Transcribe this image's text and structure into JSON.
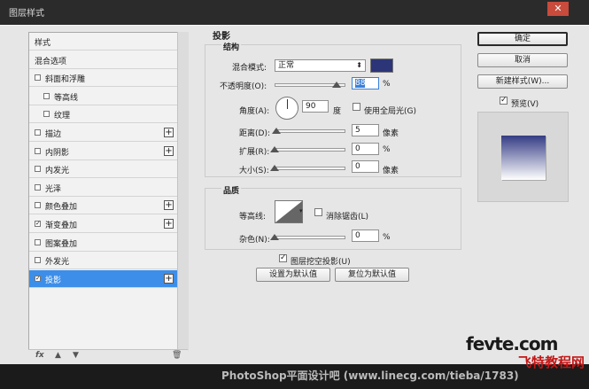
{
  "window": {
    "title": "图层样式",
    "close": "✕"
  },
  "left_panel": {
    "items": [
      {
        "label": "样式",
        "checkbox": false,
        "checked": false,
        "plus": false,
        "indent": 0,
        "selected": false
      },
      {
        "label": "混合选项",
        "checkbox": false,
        "checked": false,
        "plus": false,
        "indent": 0,
        "selected": false
      },
      {
        "label": "斜面和浮雕",
        "checkbox": true,
        "checked": false,
        "plus": false,
        "indent": 0,
        "selected": false
      },
      {
        "label": "等高线",
        "checkbox": true,
        "checked": false,
        "plus": false,
        "indent": 1,
        "selected": false
      },
      {
        "label": "纹理",
        "checkbox": true,
        "checked": false,
        "plus": false,
        "indent": 1,
        "selected": false
      },
      {
        "label": "描边",
        "checkbox": true,
        "checked": false,
        "plus": true,
        "indent": 0,
        "selected": false
      },
      {
        "label": "内阴影",
        "checkbox": true,
        "checked": false,
        "plus": true,
        "indent": 0,
        "selected": false
      },
      {
        "label": "内发光",
        "checkbox": true,
        "checked": false,
        "plus": false,
        "indent": 0,
        "selected": false
      },
      {
        "label": "光泽",
        "checkbox": true,
        "checked": false,
        "plus": false,
        "indent": 0,
        "selected": false
      },
      {
        "label": "颜色叠加",
        "checkbox": true,
        "checked": false,
        "plus": true,
        "indent": 0,
        "selected": false
      },
      {
        "label": "渐变叠加",
        "checkbox": true,
        "checked": true,
        "plus": true,
        "indent": 0,
        "selected": false
      },
      {
        "label": "图案叠加",
        "checkbox": true,
        "checked": false,
        "plus": false,
        "indent": 0,
        "selected": false
      },
      {
        "label": "外发光",
        "checkbox": true,
        "checked": false,
        "plus": false,
        "indent": 0,
        "selected": false
      },
      {
        "label": "投影",
        "checkbox": true,
        "checked": true,
        "plus": true,
        "indent": 0,
        "selected": true
      }
    ],
    "bottom_icons": {
      "fx": "fx",
      "up": "▲",
      "down": "▼",
      "trash": "🗑"
    }
  },
  "shadow": {
    "section_title": "投影",
    "structure_title": "结构",
    "blend_mode_label": "混合模式:",
    "blend_mode_value": "正常",
    "blend_color": "#2c3577",
    "opacity_label": "不透明度(O):",
    "opacity_value": "88",
    "opacity_unit": "%",
    "opacity_level": 0.88,
    "angle_label": "角度(A):",
    "angle_value": "90",
    "angle_unit": "度",
    "global_light_label": "使用全局光(G)",
    "distance_label": "距离(D):",
    "distance_value": "5",
    "distance_unit": "像素",
    "distance_level": 0.02,
    "spread_label": "扩展(R):",
    "spread_value": "0",
    "spread_unit": "%",
    "spread_level": 0,
    "size_label": "大小(S):",
    "size_value": "0",
    "size_unit": "像素",
    "size_level": 0,
    "quality_title": "品质",
    "contour_label": "等高线:",
    "antialias_label": "消除锯齿(L)",
    "noise_label": "杂色(N):",
    "noise_value": "0",
    "noise_unit": "%",
    "noise_level": 0,
    "knockout_label": "图层挖空投影(U)",
    "set_default": "设置为默认值",
    "reset_default": "复位为默认值"
  },
  "right_panel": {
    "ok": "确定",
    "cancel": "取消",
    "new_style": "新建样式(W)...",
    "preview_label": "预览(V)",
    "check": "✓"
  },
  "watermark": {
    "site": "fevte.com",
    "cn": "飞特教程网",
    "footer": "PhotoShop平面设计吧 (www.linecg.com/tieba/1783)"
  }
}
